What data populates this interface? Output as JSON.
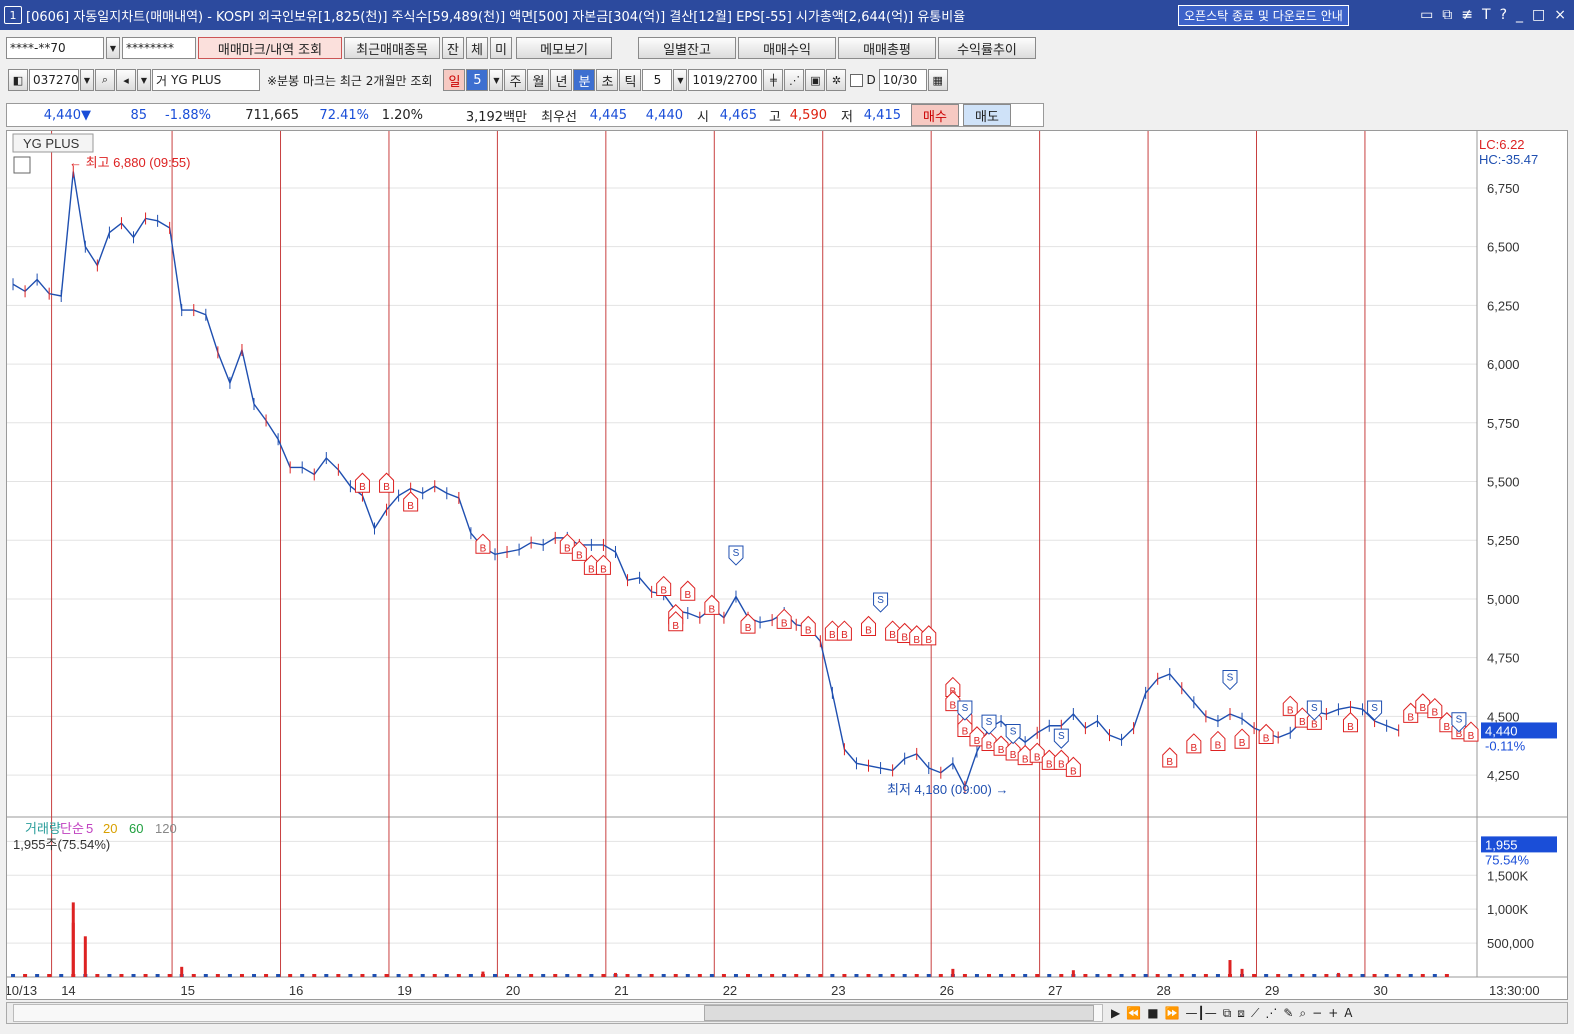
{
  "window": {
    "num": "1",
    "title": "[0606] 자동일지차트(매매내역) - KOSPI 외국인보유[1,825(천)] 주식수[59,489(천)] 액면[500] 자본금[304(억)] 결산[12월] EPS[-55] 시가총액[2,644(억)] 유통비율",
    "notice": "오픈스탁 종료 및 다운로드 안내",
    "controls": [
      "▭",
      "⧉",
      "≢",
      "T",
      "?",
      "_",
      "□",
      "×"
    ]
  },
  "toolbar1": {
    "account": "****-**70",
    "password": "********",
    "buttons": [
      "매매마크/내역 조회",
      "최근매매종목",
      "잔",
      "체",
      "미",
      "메모보기",
      "일별잔고",
      "매매수익",
      "매매총평",
      "수익률추이"
    ]
  },
  "toolbar2": {
    "code": "037270",
    "market_mark": "거",
    "name": "YG PLUS",
    "note": "※분봉 마크는 최근 2개월만 조회",
    "period_buttons": [
      "일",
      "5",
      "주",
      "월",
      "년",
      "분",
      "초",
      "틱"
    ],
    "interval": "5",
    "count": "1019",
    "total": "/2700",
    "date_label": "D",
    "date": "10/30"
  },
  "quote": {
    "price": "4,440",
    "arrow": "▼",
    "change": "85",
    "rate": "-1.88%",
    "volume": "711,665",
    "vol_ratio": "72.41%",
    "turnover": "1.20%",
    "amount": "3,192백만",
    "best_label": "최우선",
    "ask": "4,445",
    "bid": "4,440",
    "open_label": "시",
    "open": "4,465",
    "high_label": "고",
    "high": "4,590",
    "low_label": "저",
    "low": "4,415",
    "buy_btn": "매수",
    "sell_btn": "매도"
  },
  "chart_data": {
    "type": "candlestick",
    "symbol": "YG PLUS",
    "price_axis_ticks": [
      6750,
      6500,
      6250,
      6000,
      5750,
      5500,
      5250,
      5000,
      4750,
      4500,
      4250
    ],
    "price_axis_labels": [
      "6,750",
      "6,500",
      "6,250",
      "6,000",
      "5,750",
      "5,500",
      "5,250",
      "5,000",
      "4,750",
      "4,500",
      "4,250"
    ],
    "ylim": [
      4080,
      6950
    ],
    "top_right_labels": [
      "LC:6.22",
      "HC:-35.47"
    ],
    "current_price_label": "4,440",
    "current_change_label": "-0.11%",
    "high_annotation": "최고 6,880 (09:55)",
    "low_annotation": "최저 4,180 (09:00)",
    "date_ticks": [
      "10/13",
      "14",
      "15",
      "16",
      "19",
      "20",
      "21",
      "22",
      "23",
      "26",
      "27",
      "28",
      "29",
      "30"
    ],
    "time_label": "13:30:00",
    "price_path": [
      [
        0,
        6340
      ],
      [
        1,
        6310
      ],
      [
        2,
        6360
      ],
      [
        3,
        6300
      ],
      [
        4,
        6290
      ],
      [
        5,
        6820
      ],
      [
        6,
        6500
      ],
      [
        7,
        6420
      ],
      [
        8,
        6560
      ],
      [
        9,
        6600
      ],
      [
        10,
        6540
      ],
      [
        11,
        6620
      ],
      [
        12,
        6610
      ],
      [
        13,
        6580
      ],
      [
        14,
        6230
      ],
      [
        15,
        6230
      ],
      [
        16,
        6210
      ],
      [
        17,
        6050
      ],
      [
        18,
        5920
      ],
      [
        19,
        6060
      ],
      [
        20,
        5830
      ],
      [
        21,
        5760
      ],
      [
        22,
        5680
      ],
      [
        23,
        5560
      ],
      [
        24,
        5560
      ],
      [
        25,
        5530
      ],
      [
        26,
        5600
      ],
      [
        27,
        5550
      ],
      [
        28,
        5480
      ],
      [
        29,
        5440
      ],
      [
        30,
        5300
      ],
      [
        31,
        5380
      ],
      [
        32,
        5440
      ],
      [
        33,
        5470
      ],
      [
        34,
        5450
      ],
      [
        35,
        5480
      ],
      [
        36,
        5450
      ],
      [
        37,
        5430
      ],
      [
        38,
        5280
      ],
      [
        39,
        5220
      ],
      [
        40,
        5190
      ],
      [
        41,
        5200
      ],
      [
        42,
        5210
      ],
      [
        43,
        5240
      ],
      [
        44,
        5230
      ],
      [
        45,
        5260
      ],
      [
        46,
        5260
      ],
      [
        47,
        5230
      ],
      [
        48,
        5230
      ],
      [
        49,
        5230
      ],
      [
        50,
        5200
      ],
      [
        51,
        5080
      ],
      [
        52,
        5090
      ],
      [
        53,
        5030
      ],
      [
        54,
        5020
      ],
      [
        55,
        4950
      ],
      [
        56,
        4940
      ],
      [
        57,
        4920
      ],
      [
        58,
        4960
      ],
      [
        59,
        4920
      ],
      [
        60,
        5010
      ],
      [
        61,
        4920
      ],
      [
        62,
        4900
      ],
      [
        63,
        4910
      ],
      [
        64,
        4940
      ],
      [
        65,
        4890
      ],
      [
        66,
        4880
      ],
      [
        67,
        4820
      ],
      [
        68,
        4600
      ],
      [
        69,
        4360
      ],
      [
        70,
        4300
      ],
      [
        71,
        4290
      ],
      [
        72,
        4280
      ],
      [
        73,
        4270
      ],
      [
        74,
        4320
      ],
      [
        75,
        4340
      ],
      [
        76,
        4280
      ],
      [
        77,
        4260
      ],
      [
        78,
        4300
      ],
      [
        79,
        4200
      ],
      [
        80,
        4350
      ],
      [
        81,
        4450
      ],
      [
        82,
        4480
      ],
      [
        83,
        4430
      ],
      [
        84,
        4390
      ],
      [
        85,
        4430
      ],
      [
        86,
        4460
      ],
      [
        87,
        4460
      ],
      [
        88,
        4510
      ],
      [
        89,
        4450
      ],
      [
        90,
        4480
      ],
      [
        91,
        4420
      ],
      [
        92,
        4400
      ],
      [
        93,
        4450
      ],
      [
        94,
        4600
      ],
      [
        95,
        4660
      ],
      [
        96,
        4680
      ],
      [
        97,
        4620
      ],
      [
        98,
        4560
      ],
      [
        99,
        4500
      ],
      [
        100,
        4480
      ],
      [
        101,
        4510
      ],
      [
        102,
        4490
      ],
      [
        103,
        4450
      ],
      [
        104,
        4430
      ],
      [
        105,
        4410
      ],
      [
        106,
        4430
      ],
      [
        107,
        4480
      ],
      [
        108,
        4520
      ],
      [
        109,
        4510
      ],
      [
        110,
        4530
      ],
      [
        111,
        4540
      ],
      [
        112,
        4530
      ],
      [
        113,
        4480
      ],
      [
        114,
        4460
      ],
      [
        115,
        4440
      ]
    ],
    "buy_marks": [
      [
        29,
        5480
      ],
      [
        31,
        5480
      ],
      [
        33,
        5400
      ],
      [
        39,
        5220
      ],
      [
        46,
        5220
      ],
      [
        47,
        5190
      ],
      [
        48,
        5130
      ],
      [
        49,
        5130
      ],
      [
        54,
        5040
      ],
      [
        55,
        4920
      ],
      [
        55,
        4890
      ],
      [
        56,
        5020
      ],
      [
        58,
        4960
      ],
      [
        61,
        4880
      ],
      [
        64,
        4900
      ],
      [
        66,
        4870
      ],
      [
        68,
        4850
      ],
      [
        69,
        4850
      ],
      [
        71,
        4870
      ],
      [
        73,
        4850
      ],
      [
        74,
        4840
      ],
      [
        75,
        4830
      ],
      [
        76,
        4830
      ],
      [
        78,
        4610
      ],
      [
        78,
        4550
      ],
      [
        79,
        4480
      ],
      [
        79,
        4440
      ],
      [
        80,
        4400
      ],
      [
        81,
        4380
      ],
      [
        82,
        4360
      ],
      [
        83,
        4340
      ],
      [
        84,
        4320
      ],
      [
        85,
        4330
      ],
      [
        86,
        4300
      ],
      [
        87,
        4300
      ],
      [
        88,
        4270
      ],
      [
        96,
        4310
      ],
      [
        98,
        4370
      ],
      [
        100,
        4380
      ],
      [
        102,
        4390
      ],
      [
        104,
        4410
      ],
      [
        106,
        4530
      ],
      [
        107,
        4480
      ],
      [
        108,
        4470
      ],
      [
        111,
        4460
      ],
      [
        116,
        4500
      ],
      [
        117,
        4540
      ],
      [
        118,
        4520
      ],
      [
        119,
        4460
      ],
      [
        120,
        4430
      ],
      [
        121,
        4420
      ]
    ],
    "sell_marks": [
      [
        60,
        5200
      ],
      [
        72,
        5000
      ],
      [
        79,
        4540
      ],
      [
        81,
        4480
      ],
      [
        83,
        4440
      ],
      [
        87,
        4420
      ],
      [
        101,
        4670
      ],
      [
        108,
        4540
      ],
      [
        113,
        4540
      ],
      [
        120,
        4490
      ]
    ],
    "volume_panel": {
      "legend": [
        "거래량",
        "단순",
        "5",
        "20",
        "60",
        "120"
      ],
      "legend_colors": [
        "#2a9d9a",
        "#c040c0",
        "#c040c0",
        "#d8a000",
        "#20a040",
        "#888888"
      ],
      "current": "1,955주(75.54%)",
      "axis_ticks": [
        2000,
        1500,
        1000,
        500
      ],
      "axis_labels": [
        "2,000K",
        "1,500K",
        "1,000K",
        "500,000"
      ],
      "ylim": [
        0,
        2300
      ],
      "current_label": "1,955",
      "current_pct": "75.54%",
      "bars": [
        [
          5,
          1100
        ],
        [
          5,
          800
        ],
        [
          6,
          600
        ],
        [
          14,
          150
        ],
        [
          39,
          80
        ],
        [
          50,
          60
        ],
        [
          78,
          120
        ],
        [
          88,
          100
        ],
        [
          101,
          250
        ],
        [
          102,
          120
        ],
        [
          110,
          60
        ]
      ]
    }
  }
}
